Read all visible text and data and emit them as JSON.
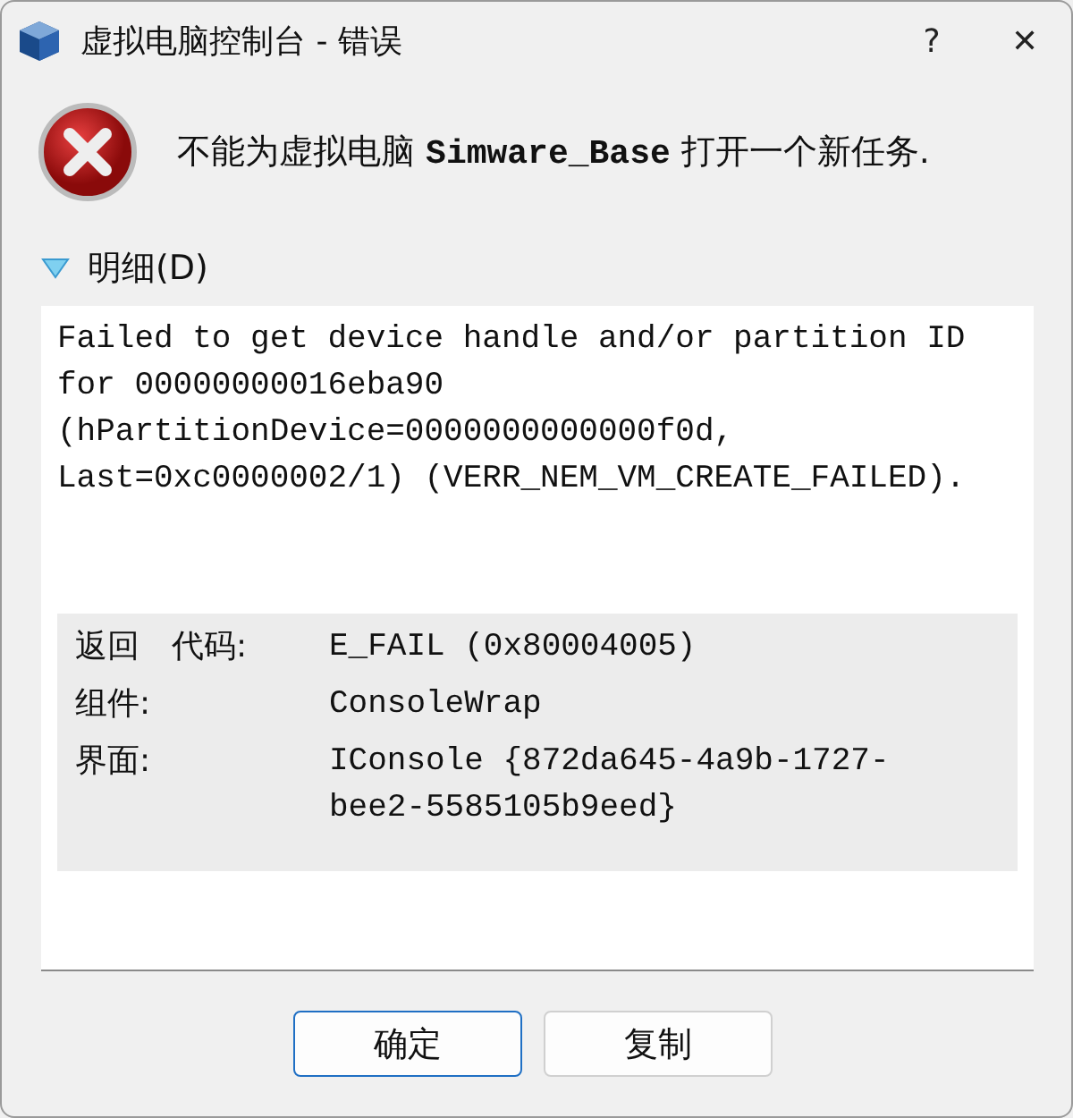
{
  "window": {
    "title": "虚拟电脑控制台 - 错误",
    "help": "?",
    "close": "✕"
  },
  "message": {
    "before": "不能为虚拟电脑 ",
    "name": "Simware_Base",
    "after": " 打开一个新任务."
  },
  "details": {
    "label": "明细(D)",
    "expanded": true,
    "text": "Failed to get device handle and/or partition ID for 00000000016eba90 (hPartitionDevice=0000000000000f0d, Last=0xc0000002/1) (VERR_NEM_VM_CREATE_FAILED).",
    "rows": [
      {
        "label": "返回　代码:",
        "value": "E_FAIL (0x80004005)"
      },
      {
        "label": "组件:",
        "value": "ConsoleWrap"
      },
      {
        "label": "界面:",
        "value": "IConsole {872da645-4a9b-1727-bee2-5585105b9eed}"
      }
    ]
  },
  "buttons": [
    {
      "label": "确定",
      "default": true
    },
    {
      "label": "复制",
      "default": false
    }
  ]
}
